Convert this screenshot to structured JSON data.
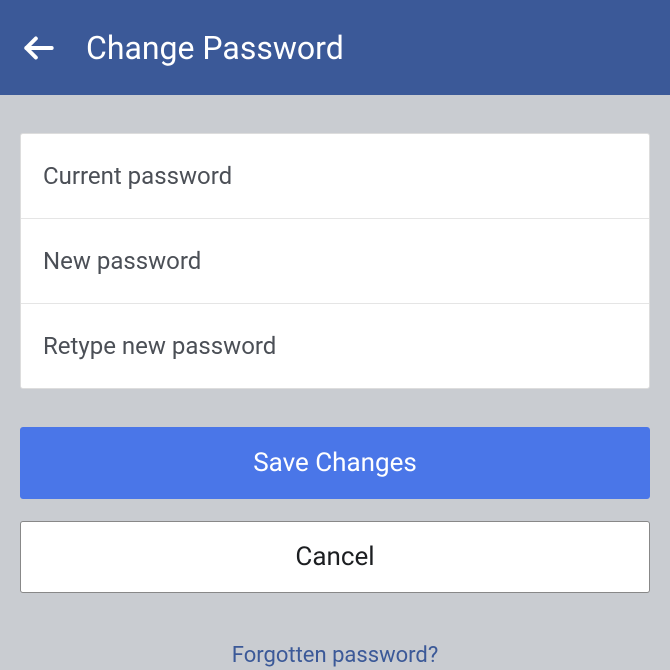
{
  "header": {
    "title": "Change Password"
  },
  "fields": {
    "current_placeholder": "Current password",
    "new_placeholder": "New password",
    "retype_placeholder": "Retype new password"
  },
  "buttons": {
    "save_label": "Save Changes",
    "cancel_label": "Cancel"
  },
  "links": {
    "forgotten_label": "Forgotten password?"
  }
}
